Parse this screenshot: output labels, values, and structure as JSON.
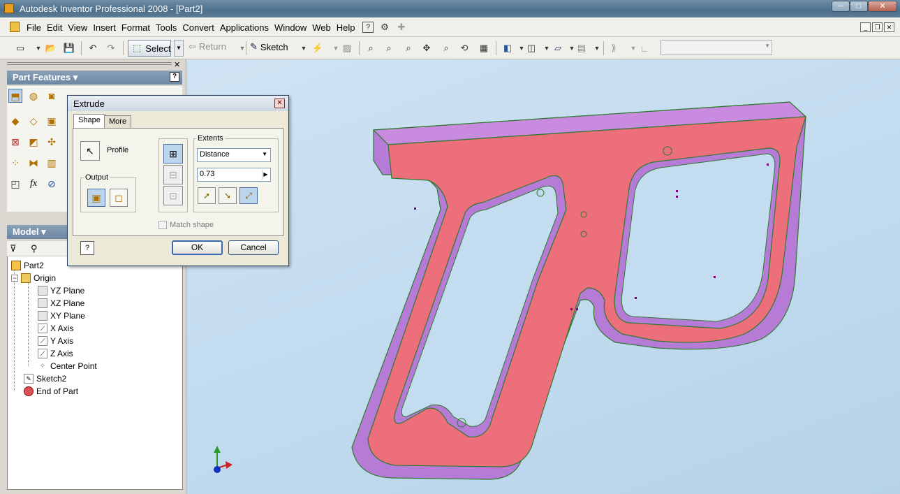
{
  "window": {
    "title": "Autodesk Inventor Professional 2008 - [Part2]",
    "min_label": "─",
    "max_label": "□",
    "close_label": "✕"
  },
  "menu": {
    "items": [
      "File",
      "Edit",
      "View",
      "Insert",
      "Format",
      "Tools",
      "Convert",
      "Applications",
      "Window",
      "Web",
      "Help"
    ],
    "mdi": [
      "_",
      "❐",
      "✕"
    ]
  },
  "toolbar": {
    "select_label": "Select",
    "return_label": "Return",
    "sketch_label": "Sketch"
  },
  "part_features": {
    "header": "Part Features ▾",
    "help": "?"
  },
  "model": {
    "header": "Model ▾",
    "tree": [
      {
        "label": "Part2",
        "icon": "part-icon"
      },
      {
        "label": "Origin",
        "icon": "folder-icon"
      },
      {
        "label": "YZ Plane",
        "icon": "plane-icon"
      },
      {
        "label": "XZ Plane",
        "icon": "plane-icon"
      },
      {
        "label": "XY Plane",
        "icon": "plane-icon"
      },
      {
        "label": "X Axis",
        "icon": "axis-icon"
      },
      {
        "label": "Y Axis",
        "icon": "axis-icon"
      },
      {
        "label": "Z Axis",
        "icon": "axis-icon"
      },
      {
        "label": "Center Point",
        "icon": "point-icon"
      },
      {
        "label": "Sketch2",
        "icon": "sketch-icon"
      },
      {
        "label": "End of Part",
        "icon": "end-of-part-icon"
      }
    ]
  },
  "dialog": {
    "title": "Extrude",
    "close": "✕",
    "tabs": [
      "Shape",
      "More"
    ],
    "profile_label": "Profile",
    "output_label": "Output",
    "extents_label": "Extents",
    "extents_type": "Distance",
    "distance_value": "0.73",
    "match_shape_label": "Match shape",
    "ok_label": "OK",
    "cancel_label": "Cancel",
    "help": "?"
  },
  "colors": {
    "part_face": "#e8707a",
    "part_side": "#b47ad8",
    "viewport_bg": "#c3dcef",
    "titlebar": "#5f7f99"
  }
}
